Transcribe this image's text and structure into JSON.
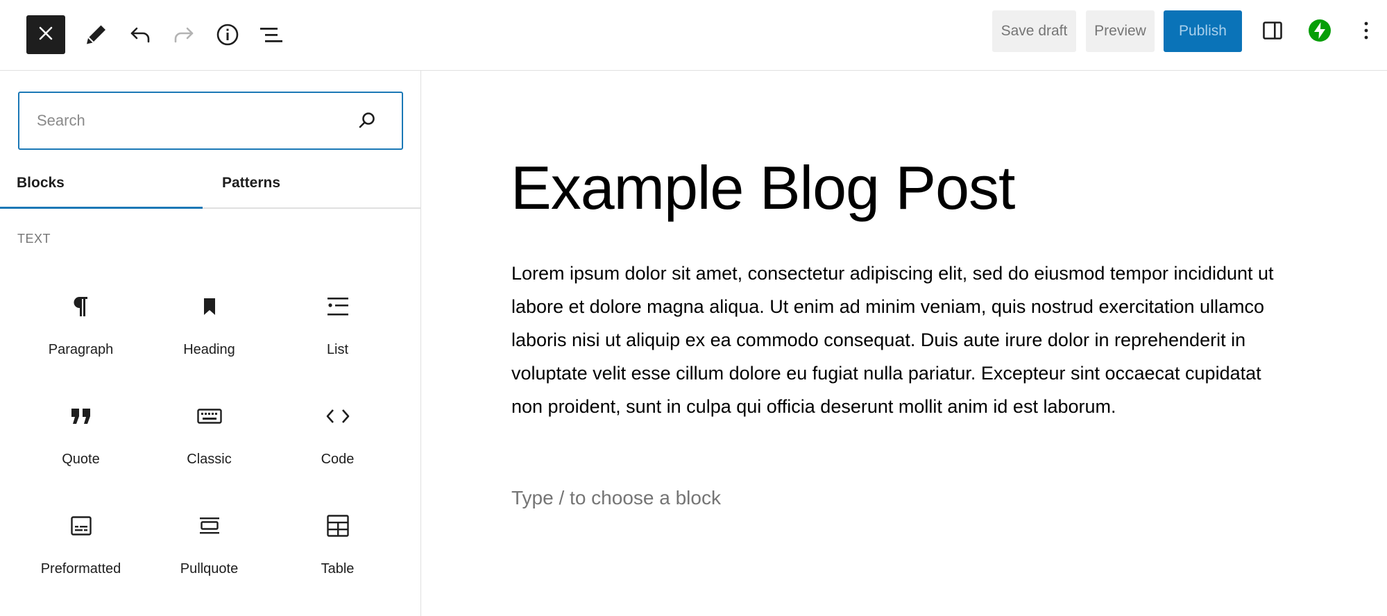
{
  "toolbar": {
    "close_icon": "close-icon",
    "tools": [
      {
        "name": "edit-tool",
        "icon": "pencil-icon"
      },
      {
        "name": "undo",
        "icon": "undo-icon"
      },
      {
        "name": "redo",
        "icon": "redo-icon"
      },
      {
        "name": "details",
        "icon": "info-icon"
      },
      {
        "name": "list-view",
        "icon": "list-view-icon"
      }
    ],
    "save_draft_label": "Save draft",
    "preview_label": "Preview",
    "publish_label": "Publish",
    "settings_icon": "sidebar-toggle-icon",
    "plugin_icon": "jetpack-bolt-icon",
    "options_icon": "more-vertical-icon",
    "colors": {
      "publish_bg": "#0a73b8",
      "accent": "#1b78b6",
      "plugin_green": "#069e08"
    }
  },
  "inserter": {
    "search": {
      "placeholder": "Search",
      "value": ""
    },
    "tabs": [
      {
        "label": "Blocks",
        "active": true
      },
      {
        "label": "Patterns",
        "active": false
      }
    ],
    "section_title": "TEXT",
    "blocks": [
      {
        "label": "Paragraph",
        "icon": "paragraph-icon"
      },
      {
        "label": "Heading",
        "icon": "heading-bookmark-icon"
      },
      {
        "label": "List",
        "icon": "list-icon"
      },
      {
        "label": "Quote",
        "icon": "quote-icon"
      },
      {
        "label": "Classic",
        "icon": "keyboard-icon"
      },
      {
        "label": "Code",
        "icon": "code-icon"
      },
      {
        "label": "Preformatted",
        "icon": "preformatted-icon"
      },
      {
        "label": "Pullquote",
        "icon": "pullquote-icon"
      },
      {
        "label": "Table",
        "icon": "table-icon"
      }
    ]
  },
  "editor": {
    "title": "Example Blog Post",
    "body": "Lorem ipsum dolor sit amet, consectetur adipiscing elit, sed do eiusmod tempor incididunt ut labore et dolore magna aliqua. Ut enim ad minim veniam, quis nostrud exercitation ullamco laboris nisi ut aliquip ex ea commodo consequat. Duis aute irure dolor in reprehenderit in voluptate velit esse cillum dolore eu fugiat nulla pariatur. Excepteur sint occaecat cupidatat non proident, sunt in culpa qui officia deserunt mollit anim id est laborum.",
    "placeholder": "Type / to choose a block"
  }
}
